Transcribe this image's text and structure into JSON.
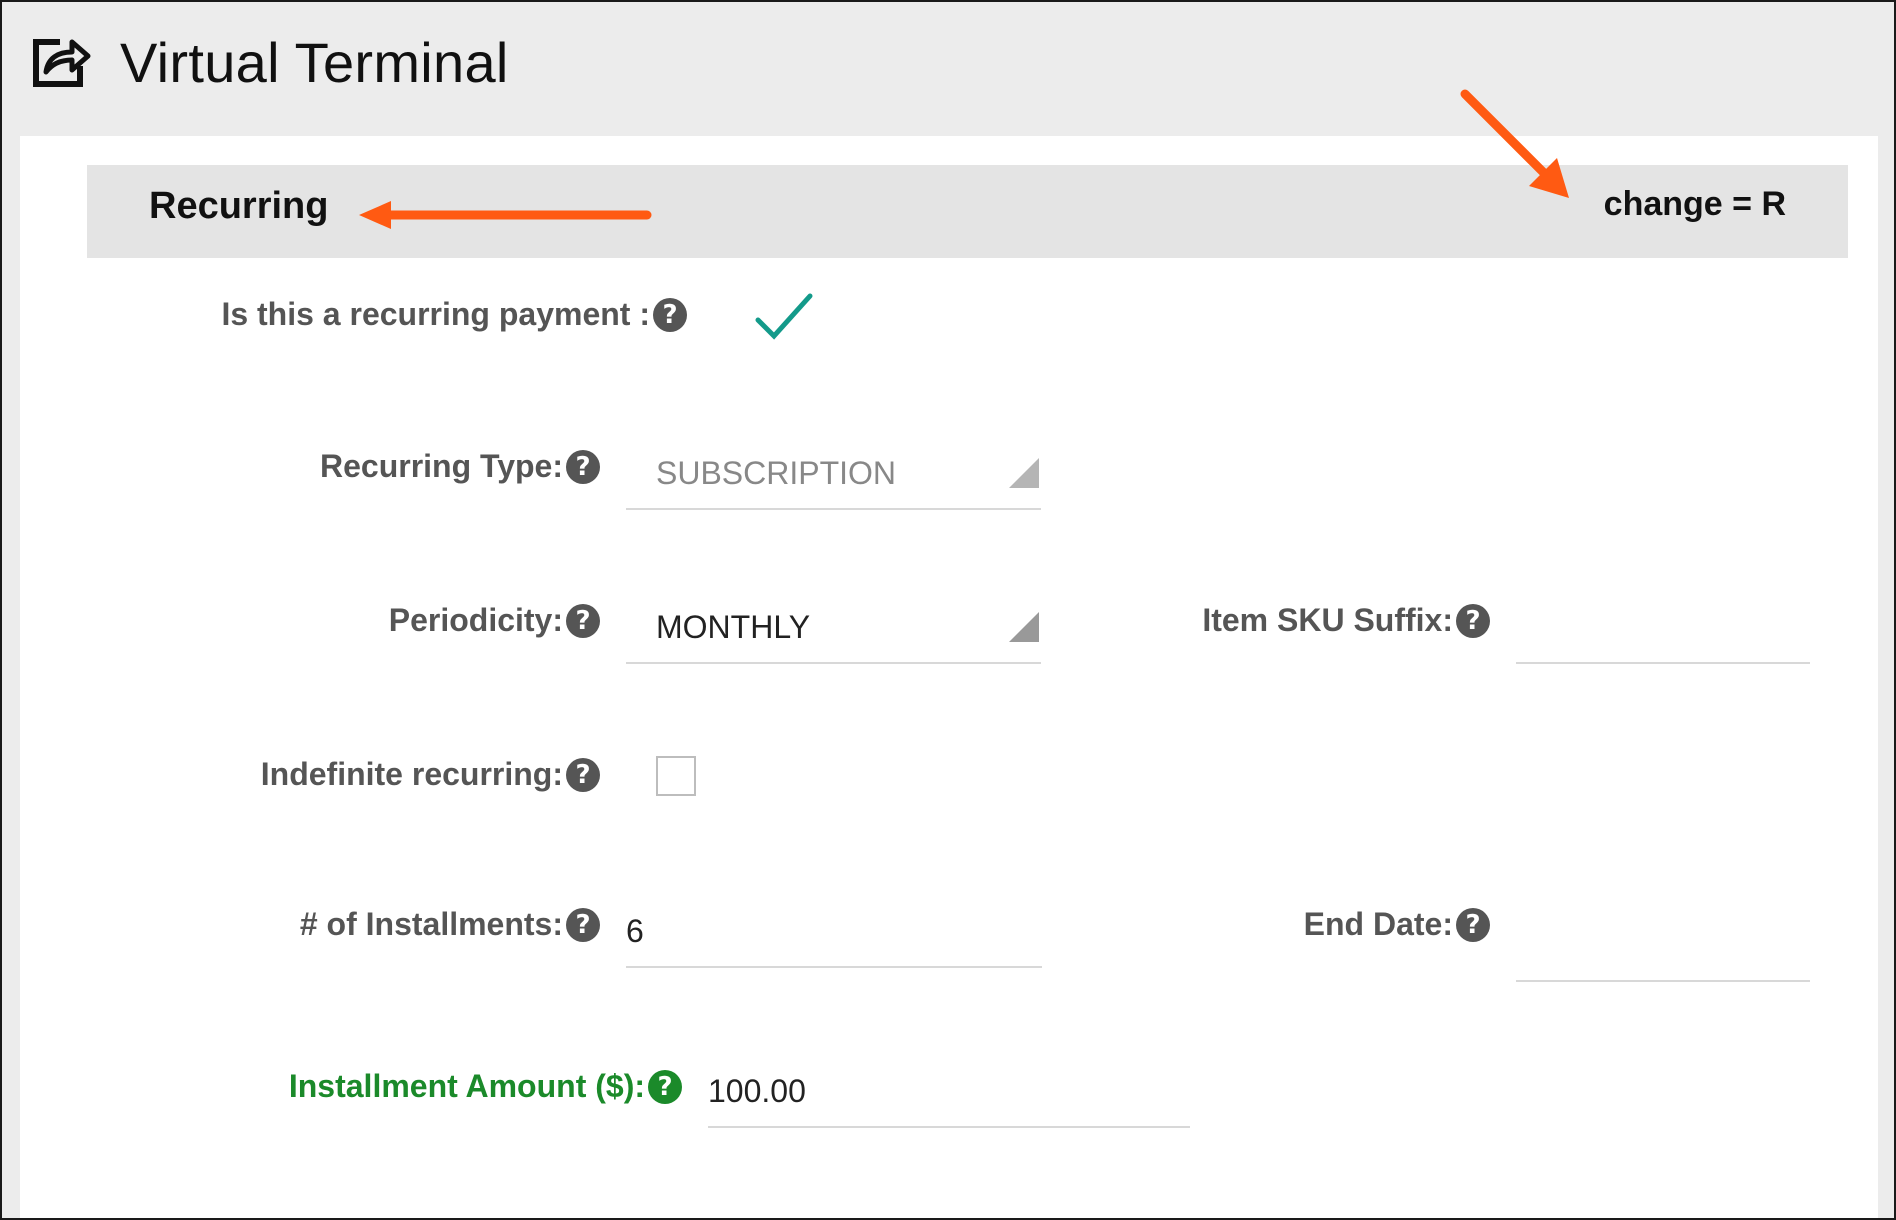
{
  "header": {
    "title": "Virtual Terminal",
    "icon": "share-box-icon"
  },
  "section": {
    "title": "Recurring",
    "right_text": "change = R"
  },
  "annotations": {
    "color": "#ff5a12"
  },
  "form": {
    "recurring_payment": {
      "label": "Is this a recurring payment :",
      "checked": true
    },
    "recurring_type": {
      "label": "Recurring Type:",
      "value": "SUBSCRIPTION"
    },
    "periodicity": {
      "label": "Periodicity:",
      "value": "MONTHLY"
    },
    "item_sku_suffix": {
      "label": "Item SKU Suffix:",
      "value": ""
    },
    "indefinite_recurring": {
      "label": "Indefinite recurring:",
      "checked": false
    },
    "installments": {
      "label": "# of Installments:",
      "value": "6"
    },
    "end_date": {
      "label": "End Date:",
      "value": ""
    },
    "installment_amount": {
      "label": "Installment Amount ($):",
      "value": "100.00"
    },
    "help_glyph": "?"
  },
  "colors": {
    "accent_green": "#1b8a2a",
    "check_teal": "#139a8a",
    "label_gray": "#555555"
  }
}
